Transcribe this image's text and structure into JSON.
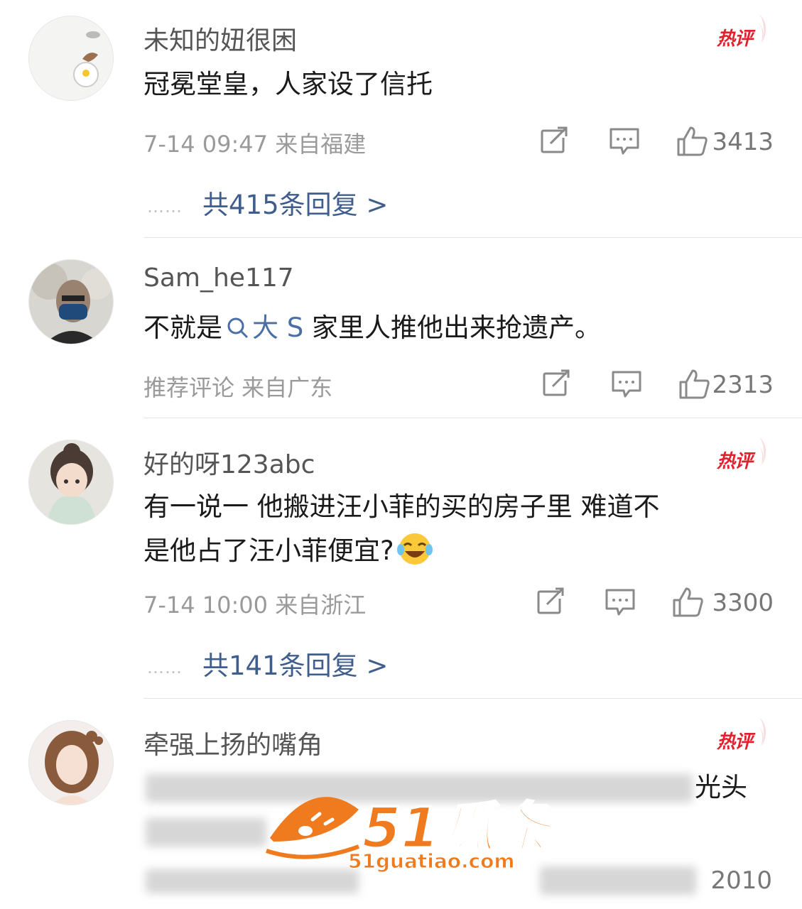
{
  "comments": [
    {
      "username": "未知的妞很困",
      "hot_label": "热评",
      "text": "冠冕堂皇，人家设了信托",
      "meta": "7-14 09:47  来自福建",
      "likes": "3413",
      "replies": "共415条回复 >"
    },
    {
      "username": "Sam_he117",
      "text_before": "不就是",
      "search_link": "大 S",
      "text_after": "家里人推他出来抢遗产。",
      "meta": "推荐评论  来自广东",
      "likes": "2313"
    },
    {
      "username": "好的呀123abc",
      "hot_label": "热评",
      "text_line1": "有一说一  他搬进汪小菲的买的房子里  难道不",
      "text_line2": "是他占了汪小菲便宜?",
      "meta": "7-14 10:00  来自浙江",
      "likes": "3300",
      "replies": "共141条回复 >"
    },
    {
      "username": "牵强上扬的嘴角",
      "hot_label": "热评",
      "visible_text_fragment": "光头",
      "likes": "2010"
    }
  ],
  "replies_dots": "……",
  "watermark": {
    "brand": "51瓜条",
    "url": "51guatiao.com"
  },
  "colors": {
    "hot": "#e0222f",
    "link": "#3f5e8c",
    "meta": "#9a9a9a",
    "watermark": "#f07a1e"
  }
}
